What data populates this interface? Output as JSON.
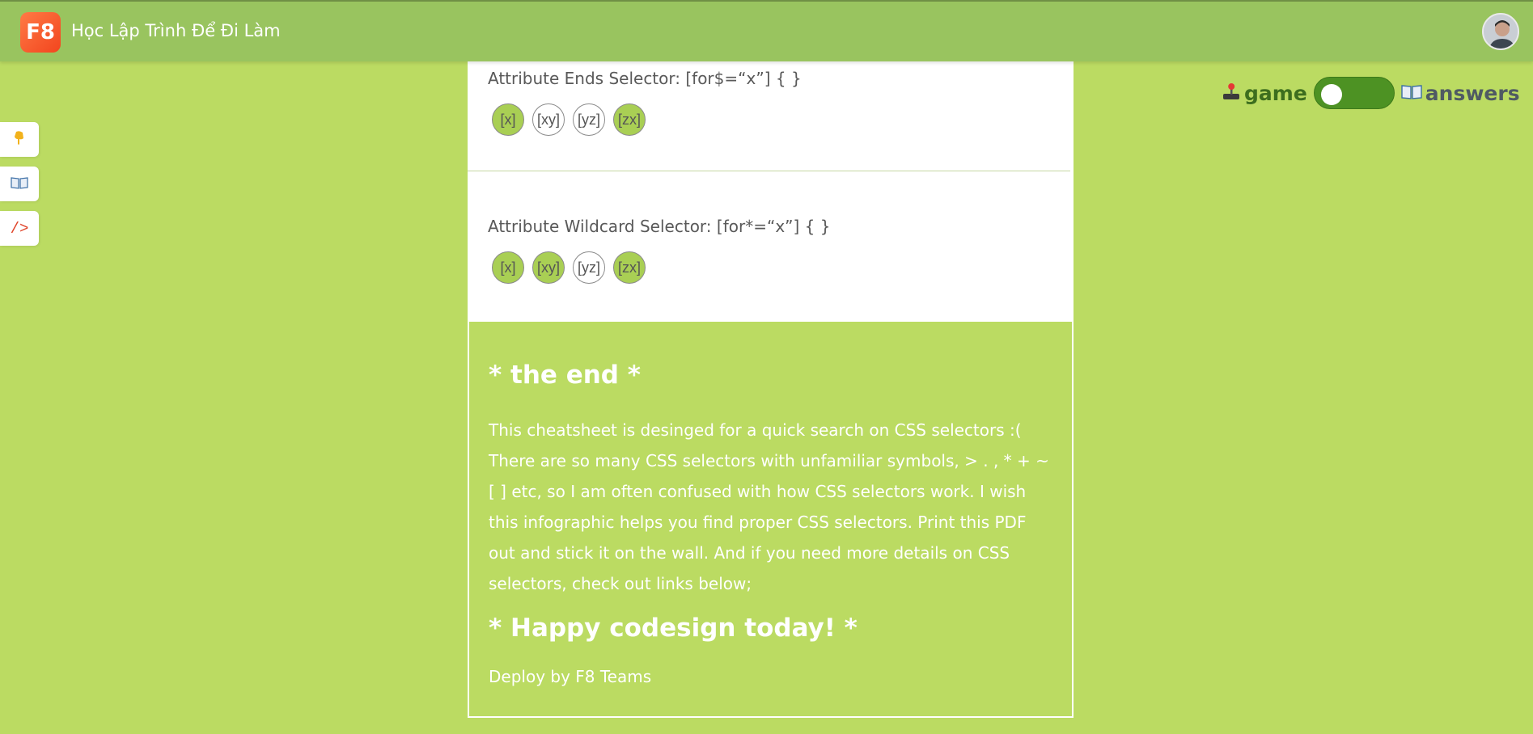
{
  "header": {
    "logo_text": "F8",
    "title": "Học Lập Trình Để Đi Làm"
  },
  "left_rail": {
    "items": [
      {
        "icon": "hand-point-down-icon"
      },
      {
        "icon": "book-icon"
      },
      {
        "icon": "code-icon",
        "label": "/>"
      }
    ]
  },
  "sections": [
    {
      "title": "Attribute Ends Selector: [for$=“x”] { }",
      "items": [
        {
          "label": "[x]",
          "active": true
        },
        {
          "label": "[xy]",
          "active": false
        },
        {
          "label": "[yz]",
          "active": false
        },
        {
          "label": "[zx]",
          "active": true
        }
      ]
    },
    {
      "title": "Attribute Wildcard Selector: [for*=“x”] { }",
      "items": [
        {
          "label": "[x]",
          "active": true
        },
        {
          "label": "[xy]",
          "active": true
        },
        {
          "label": "[yz]",
          "active": false
        },
        {
          "label": "[zx]",
          "active": true
        }
      ]
    }
  ],
  "end": {
    "title": "* the end *",
    "text": "This cheatsheet is desinged for a quick search on CSS selectors :( There are so many CSS selectors with unfamiliar symbols, > . , * + ~ [ ] etc, so I am often confused with how CSS selectors work. I wish this infographic helps you find proper CSS selectors. Print this PDF out and stick it on the wall. And if you need more details on CSS selectors, check out links below;",
    "closing": "* Happy codesign today! *",
    "deploy": "Deploy by F8 Teams"
  },
  "mode_switch": {
    "game_label": "game",
    "answers_label": "answers",
    "state": "off"
  },
  "colors": {
    "page_bg": "#bbdb62",
    "header_bg": "#99c45f",
    "active_circle": "#a9cf54",
    "toggle": "#4d9223"
  }
}
